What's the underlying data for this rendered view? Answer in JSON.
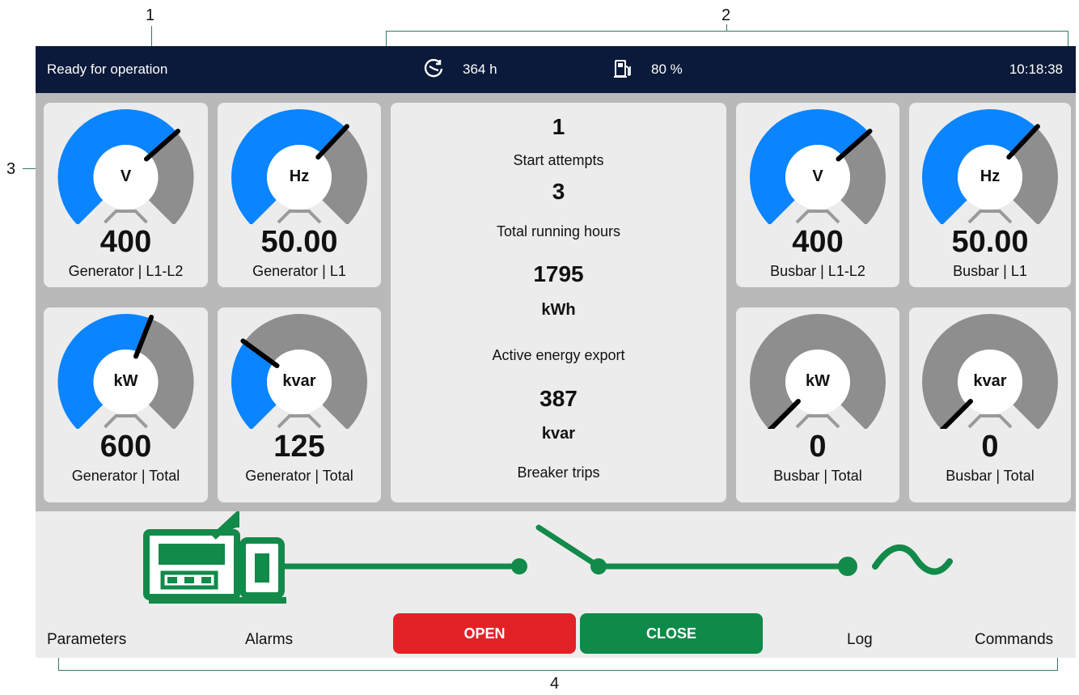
{
  "callouts": [
    "1",
    "2",
    "3",
    "4"
  ],
  "topbar": {
    "status": "Ready for operation",
    "running_hours": "364 h",
    "fuel_level": "80 %",
    "time": "10:18:38"
  },
  "colors": {
    "topbar_bg": "#0b1a3a",
    "gauge_active": "#0a84ff",
    "gauge_inactive": "#8e8e8e",
    "diagram_green": "#128a4a",
    "open_red": "#e32227",
    "close_green": "#0e8a49"
  },
  "gauges": [
    {
      "unit": "V",
      "value": "400",
      "label": "Generator | L1-L2",
      "level": 0.68
    },
    {
      "unit": "Hz",
      "value": "50.00",
      "label": "Generator | L1",
      "level": 0.66
    },
    {
      "unit": "kW",
      "value": "600",
      "label": "Generator | Total",
      "level": 0.58
    },
    {
      "unit": "kvar",
      "value": "125",
      "label": "Generator | Total",
      "level": 0.3
    },
    {
      "unit": "V",
      "value": "400",
      "label": "Busbar | L1-L2",
      "level": 0.68
    },
    {
      "unit": "Hz",
      "value": "50.00",
      "label": "Busbar | L1",
      "level": 0.66
    },
    {
      "unit": "kW",
      "value": "0",
      "label": "Busbar | Total",
      "level": 0.0
    },
    {
      "unit": "kvar",
      "value": "0",
      "label": "Busbar | Total",
      "level": 0.0
    }
  ],
  "center": {
    "start_attempts_value": "1",
    "start_attempts_label": "Start attempts",
    "running_hours_value": "3",
    "running_hours_label": "Total running hours",
    "energy_value": "1795",
    "energy_unit": "kWh",
    "energy_label": "Active energy export",
    "reactive_value": "387",
    "reactive_unit": "kvar",
    "breaker_label": "Breaker trips"
  },
  "nav": {
    "parameters": "Parameters",
    "alarms": "Alarms",
    "open": "OPEN",
    "close": "CLOSE",
    "log": "Log",
    "commands": "Commands"
  }
}
